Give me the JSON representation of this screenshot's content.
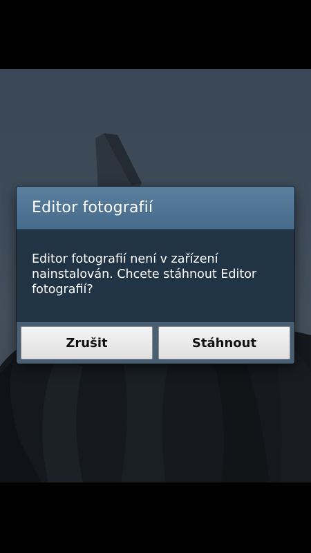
{
  "dialog": {
    "title": "Editor fotografií",
    "message": "Editor fotografií není v zařízení nainstalován. Chcete stáhnout Editor fotografií?",
    "buttons": {
      "cancel_label": "Zrušit",
      "download_label": "Stáhnout"
    }
  },
  "colors": {
    "title_bar": "#4f7595",
    "body": "#213445",
    "button_bar": "#4a5f71",
    "button_face": "#ececec"
  }
}
